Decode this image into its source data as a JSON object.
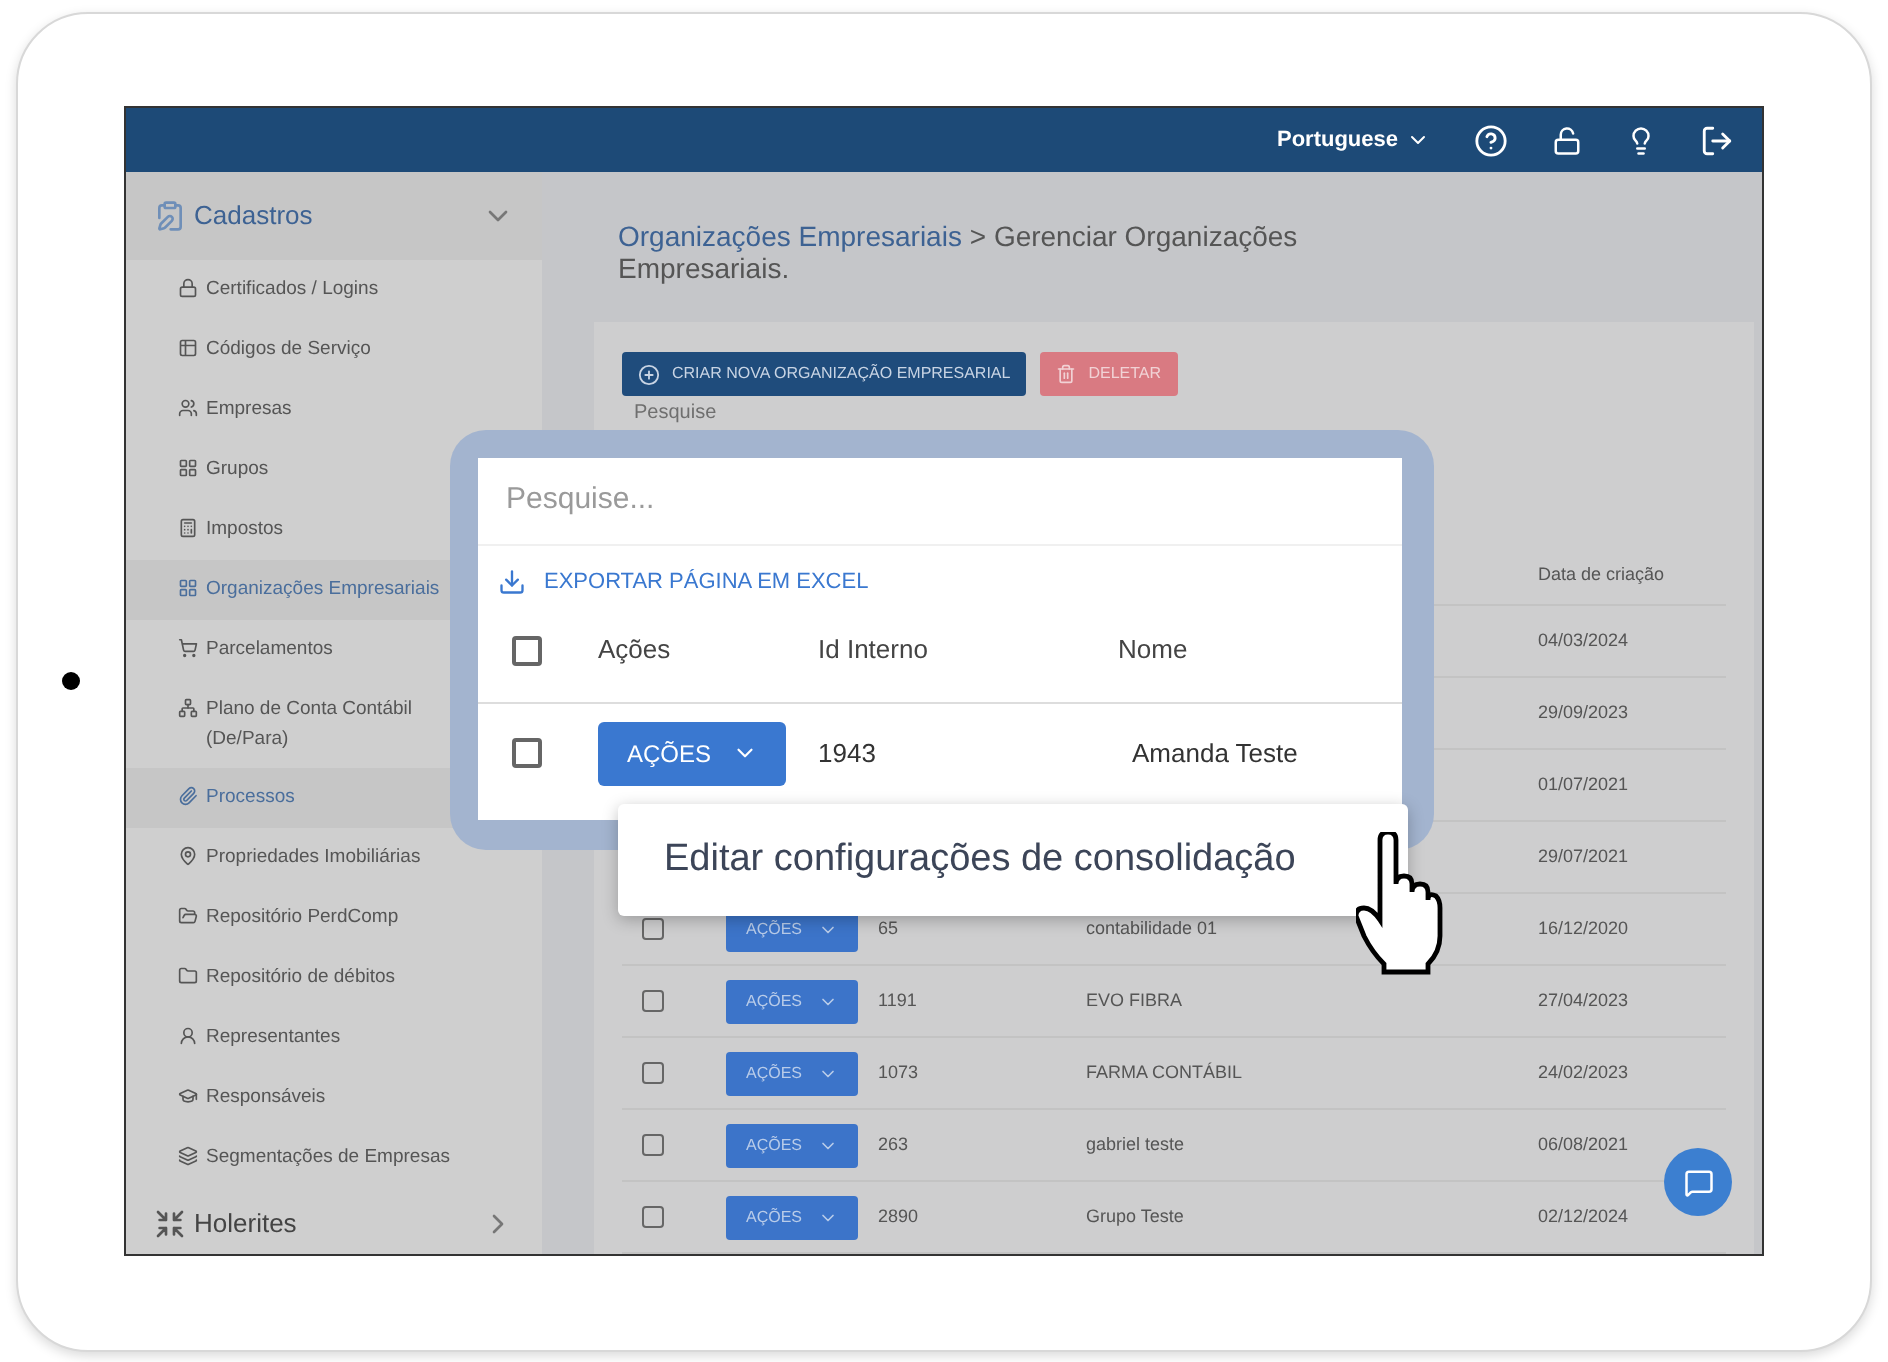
{
  "top_bar": {
    "language": "Portuguese"
  },
  "sidebar": {
    "sections": [
      {
        "label": "Cadastros",
        "expanded": true,
        "items": [
          {
            "label": "Certificados / Logins",
            "selected": false
          },
          {
            "label": "Códigos de Serviço",
            "selected": false
          },
          {
            "label": "Empresas",
            "selected": false
          },
          {
            "label": "Grupos",
            "selected": false
          },
          {
            "label": "Impostos",
            "selected": false
          },
          {
            "label": "Organizações Empresariais",
            "selected": true
          },
          {
            "label": "Parcelamentos",
            "selected": false
          },
          {
            "label": "Plano de Conta Contábil (De/Para)",
            "selected": false
          },
          {
            "label": "Processos",
            "selected": true
          },
          {
            "label": "Propriedades Imobiliárias",
            "selected": false
          },
          {
            "label": "Repositório PerdComp",
            "selected": false
          },
          {
            "label": "Repositório de débitos",
            "selected": false
          },
          {
            "label": "Representantes",
            "selected": false
          },
          {
            "label": "Responsáveis",
            "selected": false
          },
          {
            "label": "Segmentações de Empresas",
            "selected": false
          }
        ]
      },
      {
        "label": "Holerites",
        "expanded": false
      }
    ]
  },
  "breadcrumb": {
    "parent": "Organizações Empresariais",
    "separator": ">",
    "current": "Gerenciar Organizações Empresariais."
  },
  "toolbar": {
    "create_button": "CRIAR NOVA ORGANIZAÇÃO EMPRESARIAL",
    "delete_button": "DELETAR"
  },
  "background_search": {
    "placeholder": "Pesquise"
  },
  "table": {
    "date_column": "Data de criação",
    "rows": [
      {
        "date": "04/03/2024"
      },
      {
        "date": "29/09/2023"
      },
      {
        "date": "01/07/2021"
      },
      {
        "date": "29/07/2021"
      },
      {
        "checked": false,
        "action": "AÇÕES",
        "id": "65",
        "name": "contabilidade 01",
        "date": "16/12/2020"
      },
      {
        "checked": false,
        "action": "AÇÕES",
        "id": "1191",
        "name": "EVO FIBRA",
        "date": "27/04/2023"
      },
      {
        "checked": false,
        "action": "AÇÕES",
        "id": "1073",
        "name": "FARMA CONTÁBIL",
        "date": "24/02/2023"
      },
      {
        "checked": false,
        "action": "AÇÕES",
        "id": "263",
        "name": "gabriel teste",
        "date": "06/08/2021"
      },
      {
        "checked": false,
        "action": "AÇÕES",
        "id": "2890",
        "name": "Grupo Teste",
        "date": "02/12/2024"
      }
    ]
  },
  "spotlight": {
    "search_placeholder": "Pesquise...",
    "export_link": "EXPORTAR PÁGINA EM EXCEL",
    "columns": [
      "Ações",
      "Id Interno",
      "Nome"
    ],
    "row": {
      "checked": false,
      "action": "AÇÕES",
      "id": "1943",
      "name": "Amanda Teste"
    },
    "header_checked": false
  },
  "dropdown_menu": {
    "items": [
      "Editar configurações de consolidação"
    ]
  }
}
